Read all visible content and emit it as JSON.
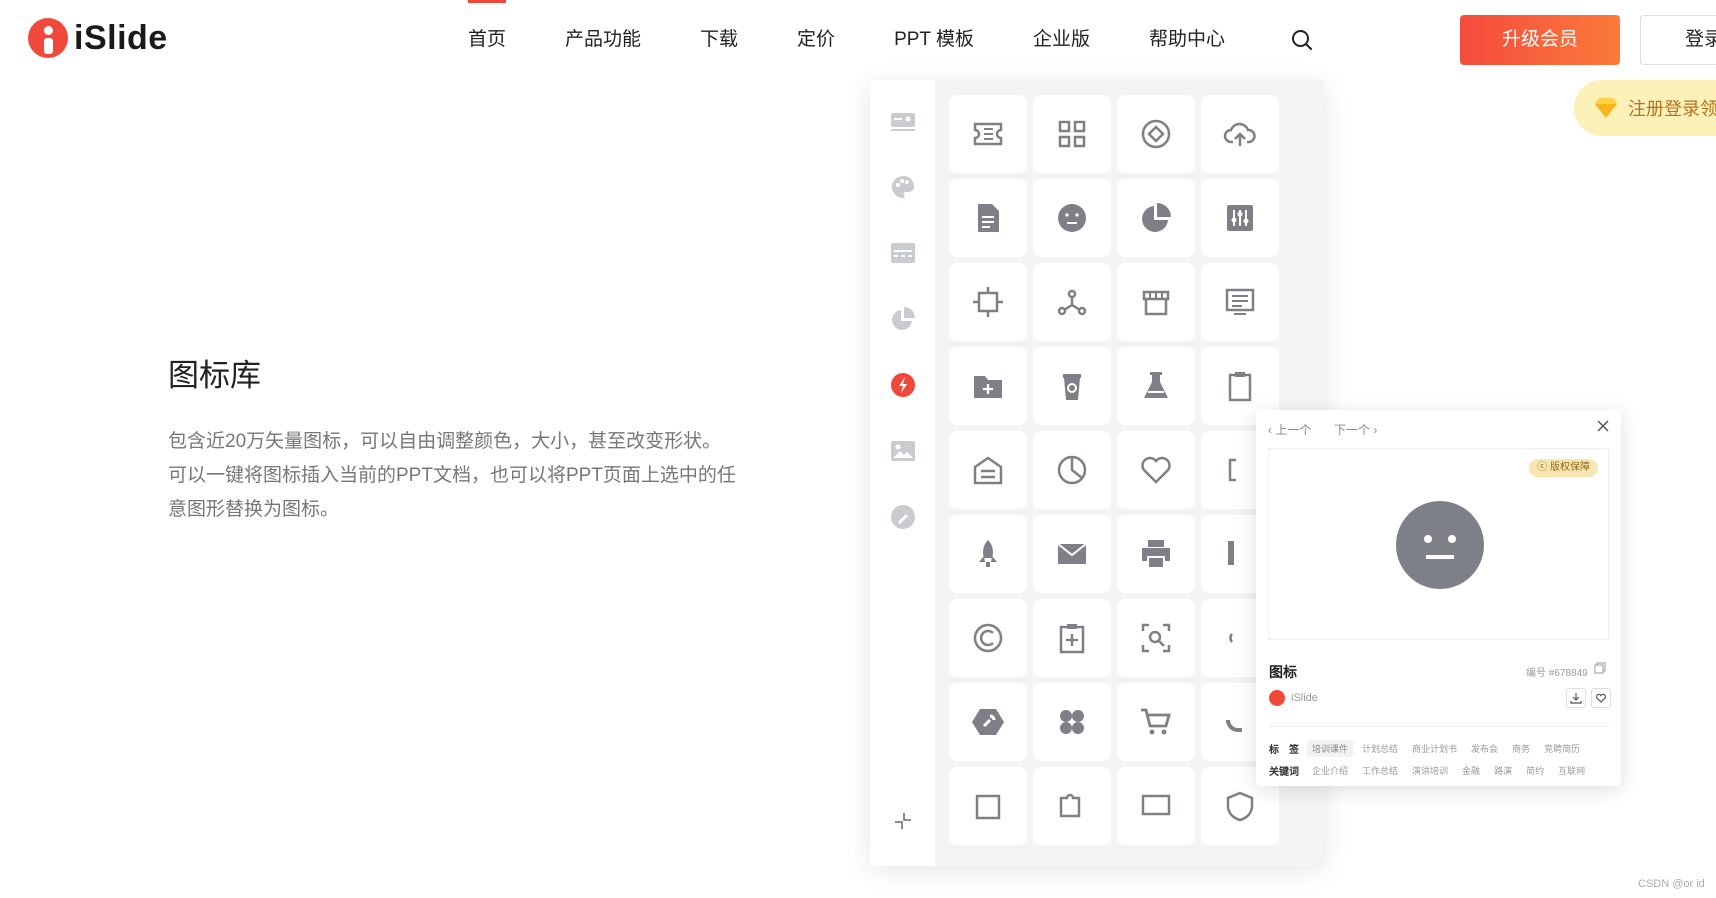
{
  "brand": {
    "name": "iSlide",
    "accent": "#f0493b"
  },
  "nav": {
    "items": [
      {
        "label": "首页",
        "active": true
      },
      {
        "label": "产品功能"
      },
      {
        "label": "下载"
      },
      {
        "label": "定价"
      },
      {
        "label": "PPT 模板"
      },
      {
        "label": "企业版"
      },
      {
        "label": "帮助中心"
      }
    ],
    "search_icon": "search-icon"
  },
  "header": {
    "upgrade_label": "升级会员",
    "login_label": "登录",
    "promo_text": "注册登录领"
  },
  "feature": {
    "title": "图标库",
    "description": "包含近20万矢量图标，可以自由调整颜色，大小，甚至改变形状。可以一键将图标插入当前的PPT文档，也可以将PPT页面上选中的任意图形替换为图标。"
  },
  "detail": {
    "prev_label": "‹ 上一个",
    "next_label": "下一个 ›",
    "badge": "ⓒ 版权保障",
    "title": "图标",
    "id_text": "编号 #678849",
    "author": "iSlide",
    "tags_label": "标　签",
    "tags": [
      "培训课件",
      "计划总结",
      "商业计划书",
      "发布会",
      "商务",
      "竞聘简历"
    ],
    "keywords_label": "关键词",
    "keywords": [
      "企业介绍",
      "工作总结",
      "演讲培训",
      "金融",
      "路演",
      "简约",
      "互联网"
    ]
  },
  "watermark": "CSDN @or id"
}
